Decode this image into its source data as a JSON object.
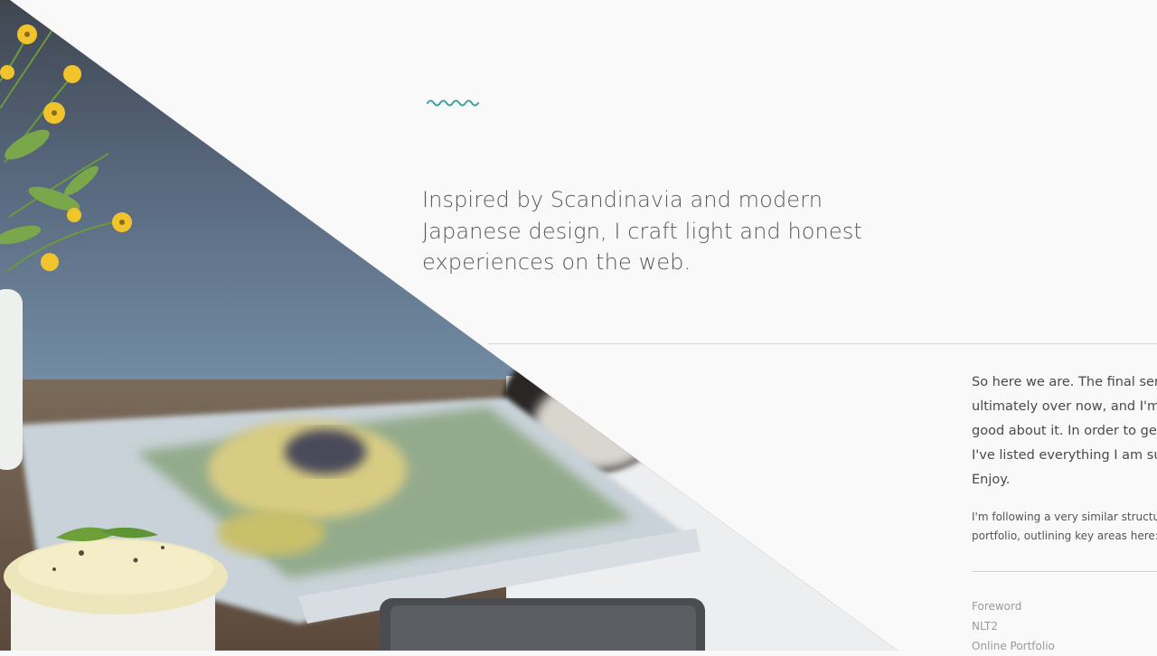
{
  "intro": {
    "line1": "Inspired by Scandinavia and modern",
    "line2": "Japanese design, I craft light and honest",
    "line3": "experiences on the web."
  },
  "article": {
    "paragraph_lines": [
      "So here we are. The final sem",
      "ultimately over now, and I'm f",
      "good about it. In order to get",
      "I've listed everything I am sub",
      "Enjoy."
    ],
    "note_lines": [
      "I'm following a very similar structure",
      "portfolio, outlining key areas here:"
    ]
  },
  "toc": {
    "items": [
      "Foreword",
      "NLT2",
      "Online Portfolio"
    ]
  },
  "colors": {
    "accent": "#3aa6a6",
    "background": "#f9f9f9",
    "intro_text": "#595959"
  },
  "icons": {
    "squiggle": "wave-ornament-icon"
  }
}
